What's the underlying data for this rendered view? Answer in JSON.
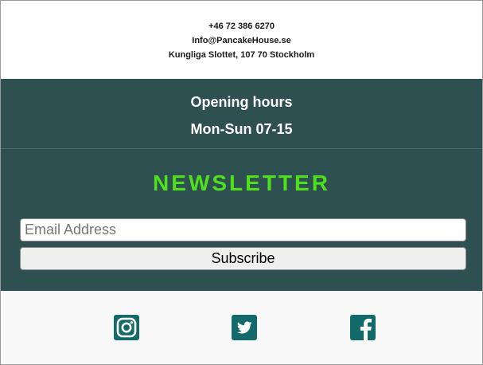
{
  "contact": {
    "phone": "+46 72 386 6270",
    "email": "Info@PancakeHouse.se",
    "address": "Kungliga Slottet, 107 70 Stockholm"
  },
  "hours": {
    "title": "Opening hours",
    "time": "Mon-Sun 07-15"
  },
  "newsletter": {
    "title": "NEWSLETTER",
    "email_placeholder": "Email Address",
    "email_value": "",
    "subscribe_label": "Subscribe"
  },
  "social": {
    "icons": [
      "instagram-icon",
      "twitter-icon",
      "facebook-icon"
    ]
  },
  "colors": {
    "dark_teal": "#2f5050",
    "accent_green": "#4fe01d",
    "icon_teal": "#126a6a",
    "footer_bg": "#f8f8f8"
  }
}
